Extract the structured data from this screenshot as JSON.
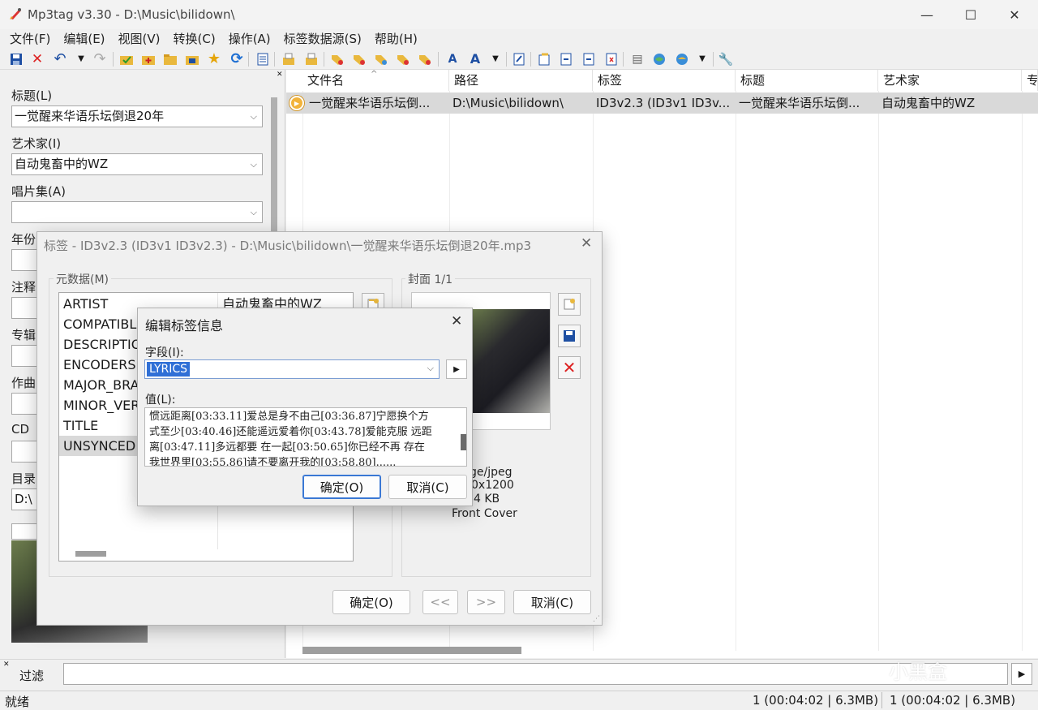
{
  "window": {
    "title": "Mp3tag v3.30  -  D:\\Music\\bilidown\\",
    "controls": {
      "minimize": "—",
      "maximize": "☐",
      "close": "✕"
    }
  },
  "menu": [
    "文件(F)",
    "编辑(E)",
    "视图(V)",
    "转换(C)",
    "操作(A)",
    "标签数据源(S)",
    "帮助(H)"
  ],
  "left_panel": {
    "title_label": "标题(L)",
    "title_value": "一觉醒来华语乐坛倒退20年",
    "artist_label": "艺术家(I)",
    "artist_value": "自动鬼畜中的WZ",
    "album_label": "唱片集(A)",
    "album_value": "",
    "year_label": "年份",
    "comment_label": "注释",
    "album_artist_label": "专辑",
    "composer_label": "作曲",
    "cd_label": "CD",
    "dir_label": "目录",
    "dir_value": "D:\\"
  },
  "file_list": {
    "columns": [
      "文件名",
      "路径",
      "标签",
      "标题",
      "艺术家",
      "专"
    ],
    "rows": [
      [
        "一觉醒来华语乐坛倒...",
        "D:\\Music\\bilidown\\",
        "ID3v2.3 (ID3v1 ID3v...",
        "一觉醒来华语乐坛倒...",
        "自动鬼畜中的WZ"
      ]
    ]
  },
  "filter": {
    "label": "过滤",
    "value": ""
  },
  "status": {
    "ready": "就绪",
    "selected": "1 (00:04:02 | 6.3MB)",
    "total": "1 (00:04:02 | 6.3MB)"
  },
  "tag_dialog": {
    "title": "标签 - ID3v2.3 (ID3v1 ID3v2.3) - D:\\Music\\bilidown\\一觉醒来华语乐坛倒退20年.mp3",
    "metadata_group": "元数据(M)",
    "cover_group": "封面 1/1",
    "metadata": [
      {
        "key": "ARTIST",
        "value": "自动鬼畜中的WZ"
      },
      {
        "key": "COMPATIBL",
        "value": ""
      },
      {
        "key": "DESCRIPTIO",
        "value": ""
      },
      {
        "key": "ENCODERSI",
        "value": ""
      },
      {
        "key": "MAJOR_BRA",
        "value": ""
      },
      {
        "key": "MINOR_VER",
        "value": ""
      },
      {
        "key": "TITLE",
        "value": ""
      },
      {
        "key": "UNSYNCED",
        "value": ""
      }
    ],
    "cover_info": [
      "ge/jpeg",
      "0x1200",
      "4 KB",
      "Front Cover"
    ],
    "ok": "确定(O)",
    "prev": "<<",
    "next": ">>",
    "cancel": "取消(C)"
  },
  "edit_dialog": {
    "title": "编辑标签信息",
    "field_label": "字段(I):",
    "field_value": "LYRICS",
    "value_label": "值(L):",
    "value_lines": [
      "惯远距离[03:33.11]爱总是身不由己[03:36.87]宁愿换个方",
      "式至少[03:40.46]还能遥远爱着你[03:43.78]爱能克服 远距",
      "离[03:47.11]多远都要 在一起[03:50.65]你已经不再 存在",
      "我世界里[03:55.86]请不要离开我的[03:58.80]......"
    ],
    "ok": "确定(O)",
    "cancel": "取消(C)"
  },
  "watermark": "小黑盒",
  "colors": {
    "selection": "#2f6fd6",
    "row_selected": "#d9d9d9",
    "window_bg": "#f0f0f0"
  }
}
